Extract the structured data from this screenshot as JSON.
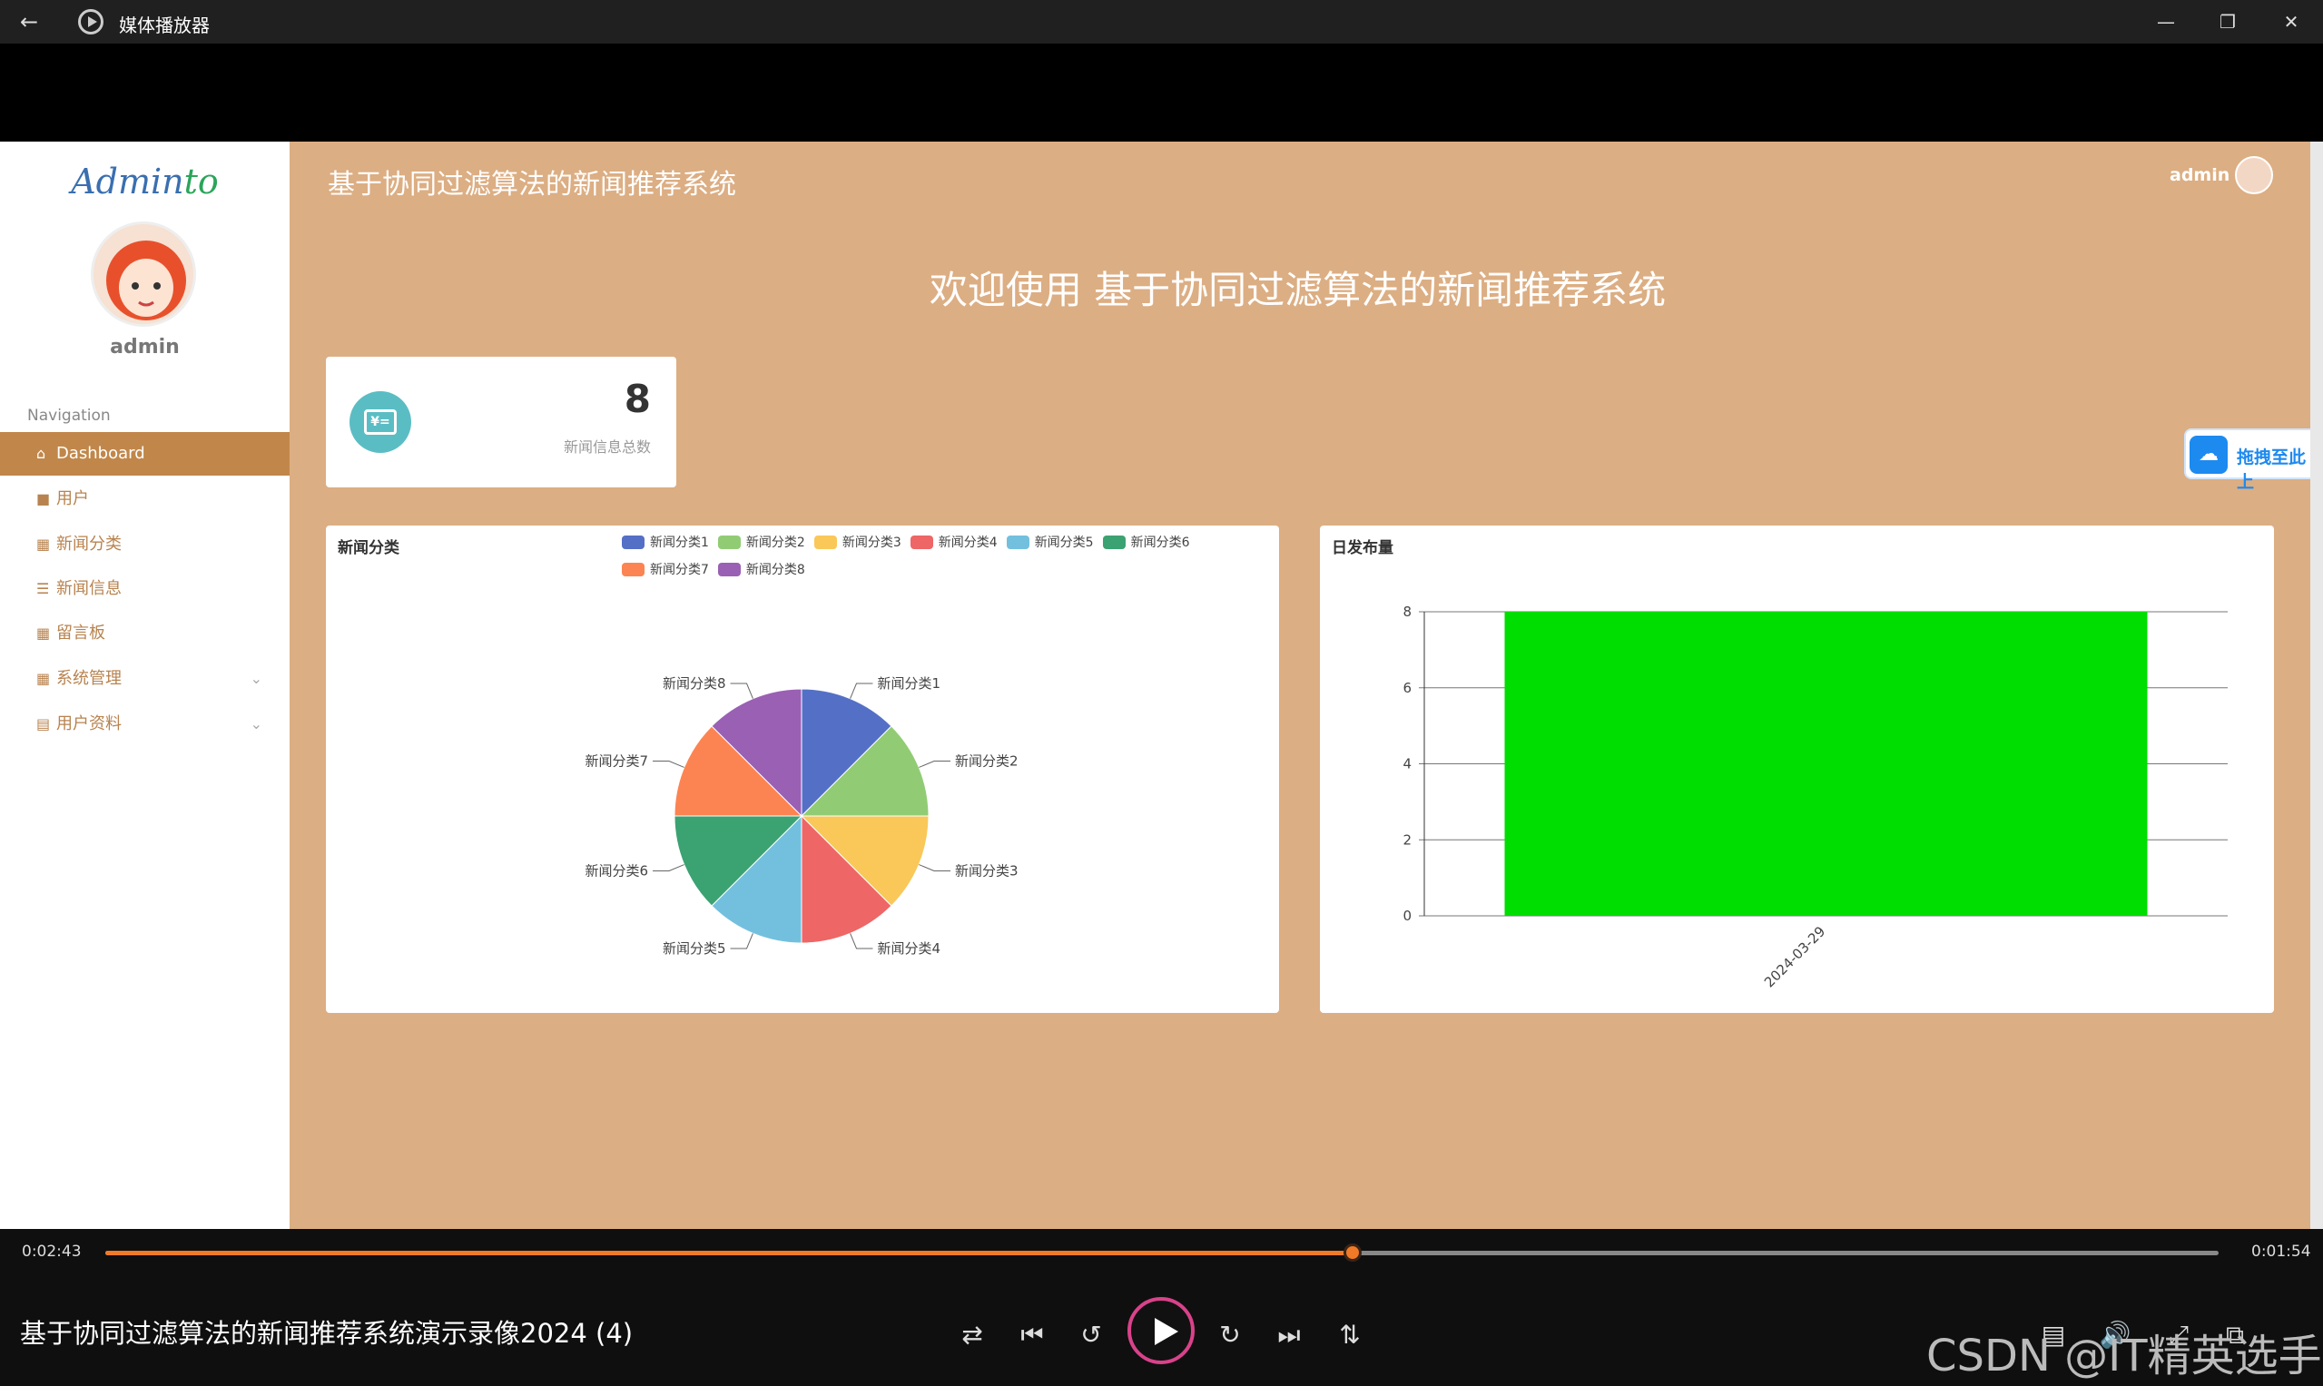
{
  "window": {
    "title": "媒体播放器"
  },
  "sidebar": {
    "logo_main": "Admin",
    "logo_tail": "to",
    "username": "admin",
    "nav_header": "Navigation",
    "items": [
      {
        "label": "Dashboard",
        "icon": "home-icon"
      },
      {
        "label": "用户",
        "icon": "user-icon"
      },
      {
        "label": "新闻分类",
        "icon": "grid-icon"
      },
      {
        "label": "新闻信息",
        "icon": "list-icon"
      },
      {
        "label": "留言板",
        "icon": "grid-icon"
      },
      {
        "label": "系统管理",
        "icon": "grid-icon",
        "expandable": true
      },
      {
        "label": "用户资料",
        "icon": "card-icon",
        "expandable": true
      }
    ]
  },
  "header": {
    "title": "基于协同过滤算法的新闻推荐系统",
    "user": "admin"
  },
  "main": {
    "welcome": "欢迎使用 基于协同过滤算法的新闻推荐系统",
    "stat": {
      "value": "8",
      "label": "新闻信息总数",
      "icon_text": "¥="
    }
  },
  "floating": {
    "cloud_label": "拖拽至此上"
  },
  "chart_data": [
    {
      "type": "pie",
      "title": "新闻分类",
      "categories": [
        "新闻分类1",
        "新闻分类2",
        "新闻分类3",
        "新闻分类4",
        "新闻分类5",
        "新闻分类6",
        "新闻分类7",
        "新闻分类8"
      ],
      "values": [
        1,
        1,
        1,
        1,
        1,
        1,
        1,
        1
      ],
      "colors": [
        "#5470c6",
        "#91cc75",
        "#fac858",
        "#ee6666",
        "#73c0de",
        "#3ba272",
        "#fc8452",
        "#9a60b4"
      ],
      "legend": "top"
    },
    {
      "type": "bar",
      "title": "日发布量",
      "categories": [
        "2024-03-29"
      ],
      "values": [
        8
      ],
      "ylim": [
        0,
        8
      ],
      "yticks": [
        "0",
        "2",
        "4",
        "6",
        "8"
      ],
      "color": "#00dd00",
      "grid": true
    }
  ],
  "player": {
    "elapsed": "0:02:43",
    "remaining": "0:01:54",
    "progress": 0.59,
    "video_title": "基于协同过滤算法的新闻推荐系统演示录像2024 (4)",
    "watermark": "CSDN @IT精英选手"
  }
}
